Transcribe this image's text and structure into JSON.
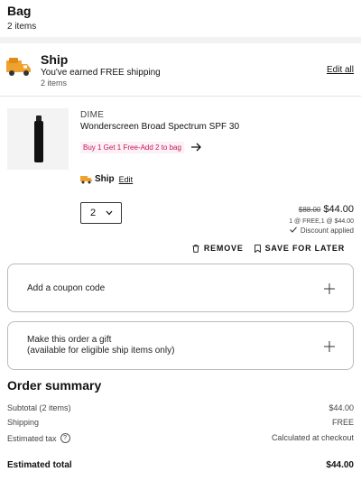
{
  "header": {
    "title": "Bag",
    "item_count": "2 items"
  },
  "shipping": {
    "title": "Ship",
    "message": "You've earned FREE shipping",
    "item_count": "2 items",
    "edit_all_label": "Edit all"
  },
  "product": {
    "brand": "DIME",
    "name": "Wonderscreen Broad Spectrum SPF 30",
    "promo": "Buy 1 Get 1 Free-Add 2 to bag",
    "ship_method": "Ship",
    "ship_edit_label": "Edit",
    "quantity": "2",
    "original_price": "$88.00",
    "price": "$44.00",
    "price_breakdown": "1 @ FREE,1 @ $44.00",
    "discount_note": "Discount applied",
    "remove_label": "REMOVE",
    "save_label": "SAVE FOR LATER"
  },
  "coupon": {
    "label": "Add a coupon code"
  },
  "gift": {
    "line1": "Make this order a gift",
    "line2": "(available for eligible ship items only)"
  },
  "summary": {
    "title": "Order summary",
    "subtotal_label": "Subtotal (2 items)",
    "subtotal_value": "$44.00",
    "shipping_label": "Shipping",
    "shipping_value": "FREE",
    "tax_label": "Estimated tax",
    "tax_value": "Calculated at checkout",
    "total_label": "Estimated total",
    "total_value": "$44.00"
  },
  "colors": {
    "promo": "#c2185b",
    "truck": "#f0a22e",
    "border": "#bbbbbb"
  },
  "icons": [
    "truck-icon",
    "arrow-right-icon",
    "chevron-down-icon",
    "trash-icon",
    "bookmark-icon",
    "plus-icon",
    "info-icon",
    "check-icon"
  ]
}
